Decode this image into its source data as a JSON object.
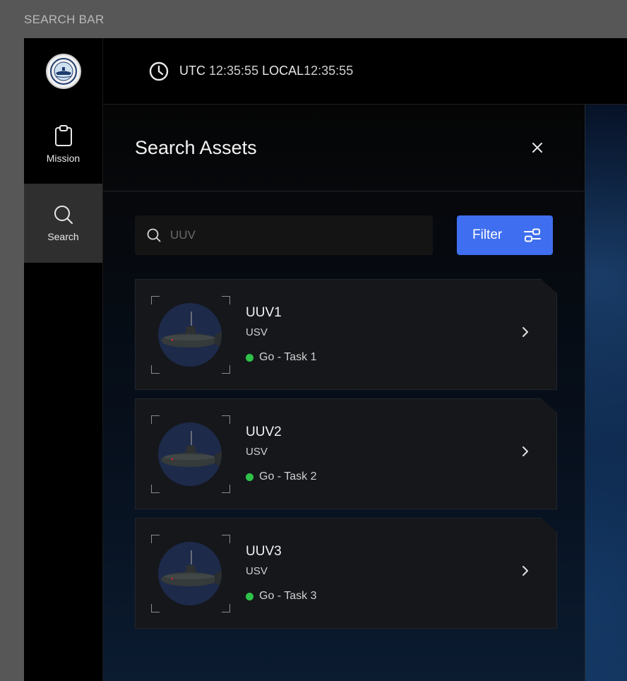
{
  "frame_label": "SEARCH BAR",
  "topbar": {
    "utc_label": "UTC",
    "utc_time": "12:35:55",
    "local_label": "LOCAL",
    "local_time": "12:35:55"
  },
  "sidebar": {
    "items": [
      {
        "label": "Mission",
        "icon": "clipboard-icon"
      },
      {
        "label": "Search",
        "icon": "search-icon"
      }
    ]
  },
  "panel": {
    "title": "Search Assets",
    "search": {
      "value": "",
      "placeholder": "UUV"
    },
    "filter_label": "Filter"
  },
  "assets": [
    {
      "name": "UUV1",
      "type": "USV",
      "status": "Go - Task 1"
    },
    {
      "name": "UUV2",
      "type": "USV",
      "status": "Go - Task 2"
    },
    {
      "name": "UUV3",
      "type": "USV",
      "status": "Go - Task 3"
    }
  ],
  "colors": {
    "accent": "#3f6ff0",
    "status_go": "#2fc24a"
  }
}
